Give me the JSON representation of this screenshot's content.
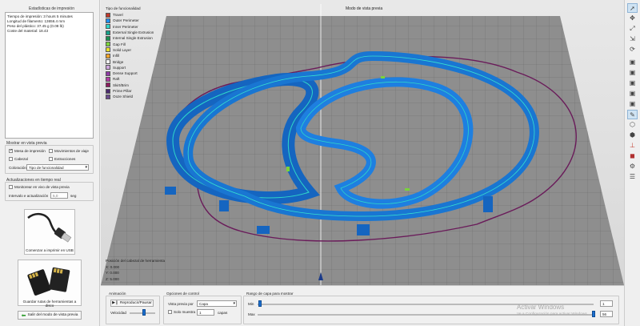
{
  "left": {
    "stats_title": "Estadísticas de impresión",
    "stats_lines": [
      "Tiempo de impresión: 3 hours 5 minutes",
      "Longitud de filamento: 13656.4 mm",
      "Peso del plástico: 37.45 g (0.08 lb)",
      "Coste del material: 18.43"
    ],
    "preview_title": "Mostrar en vista previa",
    "chk_bed": "Mesa de impresión",
    "chk_moves": "Movimientos de viaje",
    "chk_head": "Cabezal",
    "chk_retract": "Extracciones",
    "color_label": "Coloración",
    "color_value": "Tipo de funcionalidad",
    "realtime_title": "Actualizaciones en tiempo real",
    "chk_monitor": "Monitorear en vivo de vista previa",
    "interval_label": "Intervalo e actualización",
    "interval_value": "5,0",
    "interval_unit": "seg",
    "usb_label": "Comenzar a imprimir en USB",
    "sd_label": "Guardar rutas de herramientas a disco",
    "exit_label": "Salir del modo de vista previa"
  },
  "viewport": {
    "legend_title": "Tipo de funcionalidad",
    "mode_title": "Modo de vista previa",
    "legend": [
      {
        "label": "Travel",
        "color": "#c0392b"
      },
      {
        "label": "Outer Perimeter",
        "color": "#1e90ff"
      },
      {
        "label": "Inner Perimeter",
        "color": "#2fd6c9"
      },
      {
        "label": "External Single Extrusion",
        "color": "#16a089"
      },
      {
        "label": "Internal Single Extrusion",
        "color": "#1b8f52"
      },
      {
        "label": "Gap Fill",
        "color": "#7ad23b"
      },
      {
        "label": "Solid Layer",
        "color": "#e8df2a"
      },
      {
        "label": "Infill",
        "color": "#f0a32a"
      },
      {
        "label": "Bridge",
        "color": "#f2f2f2"
      },
      {
        "label": "Support",
        "color": "#cfa7de"
      },
      {
        "label": "Dense Support",
        "color": "#8e3aa4"
      },
      {
        "label": "Raft",
        "color": "#b03aa4"
      },
      {
        "label": "Skirt/Brim",
        "color": "#8c1b5e"
      },
      {
        "label": "Prime Pillar",
        "color": "#4b2c6f"
      },
      {
        "label": "Ooze Shield",
        "color": "#6b4c8f"
      }
    ],
    "pos_title": "Posición del cabezal de herramienta",
    "pos_x": "X: 0.000",
    "pos_y": "Y: 0.000",
    "pos_z": "Z: 5.000"
  },
  "toolbar_icons": [
    "cursor-icon",
    "move-icon",
    "rotate-icon",
    "scale-icon",
    "refresh-icon",
    "cube-front-icon",
    "cube-back-icon",
    "cube-left-icon",
    "cube-right-icon",
    "cube-top-icon",
    "measure-icon",
    "cube-iso-icon",
    "support-icon",
    "axis-icon",
    "cube-red-icon",
    "gear-icon",
    "settings-icon"
  ],
  "bottom": {
    "animation_title": "Animación",
    "play_label": "Reproducir/Pausar",
    "speed_label": "Velocidad",
    "control_title": "Opciones de control",
    "view_by_label": "Vista previa por",
    "view_by_value": "Capa",
    "only_show_label": "Solo muestra",
    "only_show_value": "1",
    "layers_label": "capas",
    "range_title": "Rango de capa para mostrar",
    "min_label": "Min",
    "max_label": "Max",
    "min_value": "1",
    "max_value": "56",
    "watermark_title": "Activar Windows",
    "watermark_sub": "Ve a Configuración para activar Windows."
  }
}
